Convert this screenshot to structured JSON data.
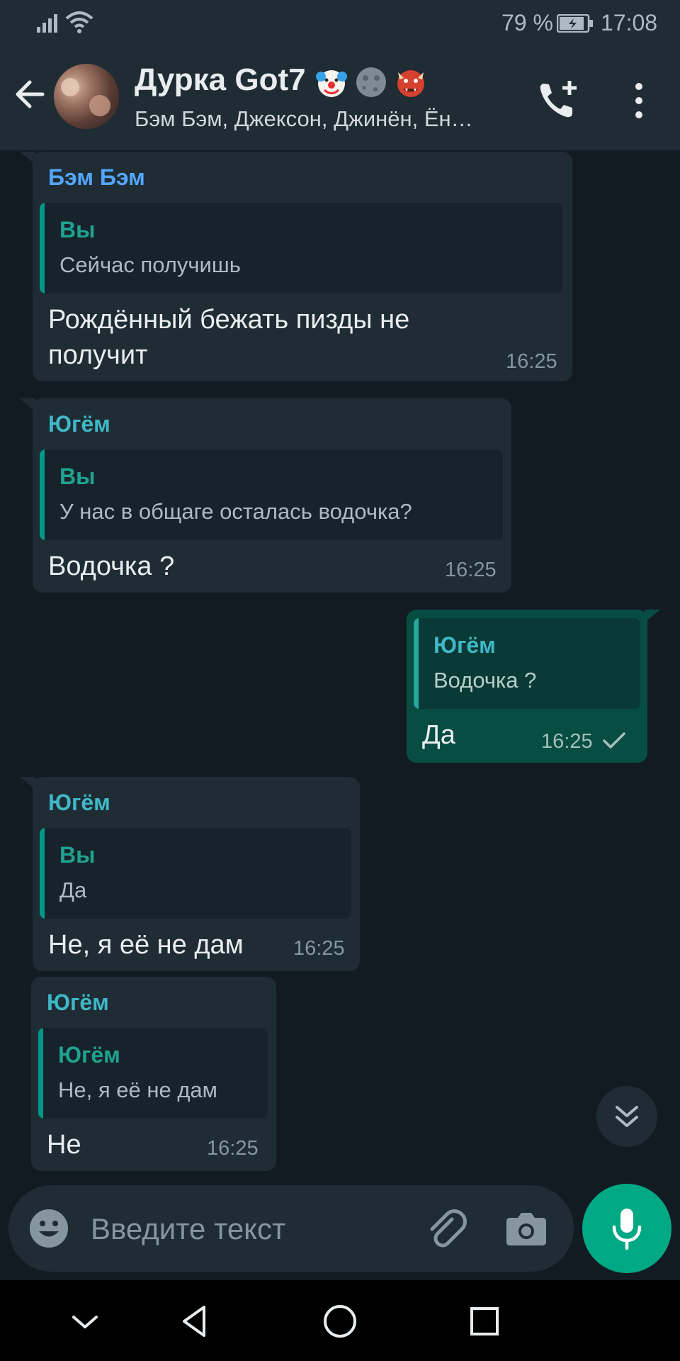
{
  "status_bar": {
    "battery_percent": "79 %",
    "time": "17:08",
    "icons": [
      "signal-icon",
      "wifi-icon",
      "battery-charging-icon"
    ]
  },
  "header": {
    "title": "Дурка Got7",
    "title_emojis": [
      "clown-face-emoji",
      "new-moon-face-emoji",
      "ogre-emoji"
    ],
    "subtitle": "Бэм Бэм, Джексон, Джинён, Ён…",
    "icons": [
      "back-arrow-icon",
      "add-call-icon",
      "more-vert-icon"
    ]
  },
  "messages": [
    {
      "direction": "incoming",
      "sender": "Бэм Бэм",
      "sender_color": "#53a6fd",
      "quote": {
        "author": "Вы",
        "text": "Сейчас получишь"
      },
      "text_lines": [
        "Рождённый бежать пизды не",
        "получит"
      ],
      "time": "16:25"
    },
    {
      "direction": "incoming",
      "sender": "Югём",
      "sender_color": "#3fb8c7",
      "quote": {
        "author": "Вы",
        "text": "У нас в общаге осталась водочка?"
      },
      "text_lines": [
        "Водочка ?"
      ],
      "time": "16:25"
    },
    {
      "direction": "outgoing",
      "quote": {
        "author": "Югём",
        "text": "Водочка ?"
      },
      "text_lines": [
        "Да"
      ],
      "time": "16:25",
      "status": "sent-check-icon"
    },
    {
      "direction": "incoming",
      "sender": "Югём",
      "sender_color": "#3fb8c7",
      "quote": {
        "author": "Вы",
        "text": "Да"
      },
      "text_lines": [
        "Не,  я её не дам"
      ],
      "time": "16:25"
    },
    {
      "direction": "incoming",
      "sender": "Югём",
      "sender_color": "#3fb8c7",
      "quote": {
        "author": "Югём",
        "text": "Не,  я её не дам"
      },
      "text_lines": [
        "Не"
      ],
      "time": "16:25"
    }
  ],
  "composer": {
    "placeholder": "Введите текст",
    "icons": [
      "emoji-icon",
      "attach-icon",
      "camera-icon",
      "mic-icon",
      "scroll-down-icon"
    ]
  },
  "colors": {
    "background": "#121b22",
    "bar": "#1f2c34",
    "incoming_bubble": "#1f2c34",
    "outgoing_bubble": "#074d42",
    "accent": "#00a884"
  },
  "nav_icons": [
    "nav-hide-icon",
    "nav-back-icon",
    "nav-home-icon",
    "nav-recents-icon"
  ]
}
